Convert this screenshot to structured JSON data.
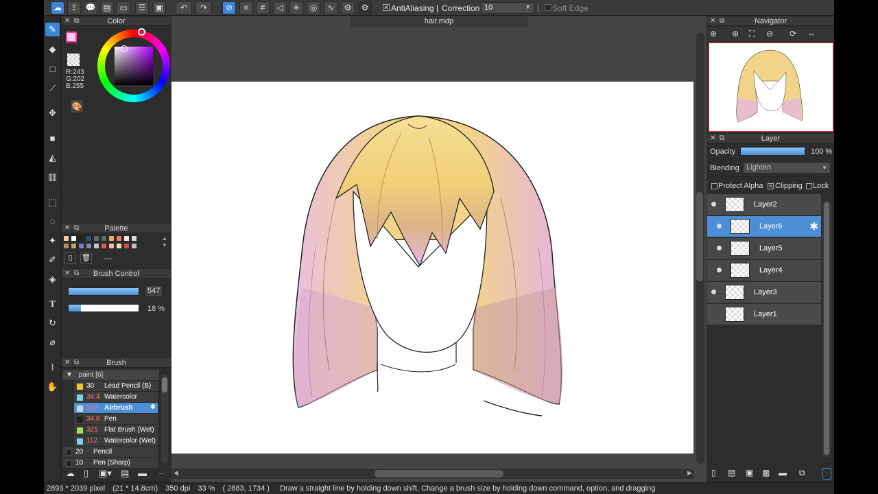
{
  "document": {
    "tab_title": "hair.mdp"
  },
  "toolbar": {
    "antialiasing_label": "AntiAliasing",
    "correction_label": "Correction",
    "correction_value": "10",
    "soft_edge_label": "Soft Edge"
  },
  "color": {
    "title": "Color",
    "rgb": {
      "r": "R:243",
      "g": "G:202",
      "b": "B:255"
    },
    "foreground": "#f3caff",
    "background": "#ffffff"
  },
  "palette": {
    "title": "Palette",
    "swatches": [
      "#f6c7a0",
      "#ffffff",
      "#222222",
      "#3b4b7a",
      "#6a6a6a",
      "#4d6e7c",
      "#e6b25f",
      "#ff7070",
      "#fbe7dc",
      "#d9d9d9",
      "#b88a64",
      "#c2a26a",
      "#7b7bd0",
      "#8a8aaa",
      "#c7c3d0",
      "#e35959",
      "#f7b6b6",
      "#f0e0b0",
      "#cc5050",
      "#c1c1c1"
    ],
    "empty_label": "---"
  },
  "brush_control": {
    "title": "Brush Control",
    "size_value": "547",
    "size_fill": 1.0,
    "opacity_value": "18 %",
    "opacity_fill": 0.18
  },
  "brush": {
    "title": "Brush",
    "group_label": "paint [6]",
    "items": [
      {
        "size": "30",
        "name": "Lead Pencil (B)",
        "color": "#e8c82a",
        "red": false
      },
      {
        "size": "34.4",
        "name": "Watercolor",
        "color": "#7fd3f2",
        "red": true
      },
      {
        "size": "547",
        "name": "Airbrush",
        "color": "#cfd7e6",
        "red": true
      },
      {
        "size": "34.8",
        "name": "Pen",
        "color": "#222222",
        "red": true
      },
      {
        "size": "321",
        "name": "Flat Brush (Wet)",
        "color": "#a6dd5a",
        "red": true
      },
      {
        "size": "112",
        "name": "Watercolor (Wet)",
        "color": "#7fd3f2",
        "red": true
      }
    ],
    "extra_items": [
      {
        "size": "20",
        "name": "Pencil"
      },
      {
        "size": "10",
        "name": "Pen (Sharp)"
      }
    ]
  },
  "navigator": {
    "title": "Navigator"
  },
  "layer": {
    "title": "Layer",
    "opacity_label": "Opacity",
    "opacity_value": "100 %",
    "opacity_fill": 1.0,
    "blending_label": "Blending",
    "blending_value": "Lighten",
    "protect_alpha_label": "Protect Alpha",
    "clipping_label": "Clipping",
    "lock_label": "Lock",
    "items": [
      {
        "name": "Layer2",
        "visible": true,
        "selected": false,
        "clipped": false
      },
      {
        "name": "Layer6",
        "visible": true,
        "selected": true,
        "clipped": true
      },
      {
        "name": "Layer5",
        "visible": true,
        "selected": false,
        "clipped": true
      },
      {
        "name": "Layer4",
        "visible": true,
        "selected": false,
        "clipped": true
      },
      {
        "name": "Layer3",
        "visible": true,
        "selected": false,
        "clipped": false
      },
      {
        "name": "Layer1",
        "visible": false,
        "selected": false,
        "clipped": false
      }
    ]
  },
  "status": {
    "pixels": "2893 * 2039 pixel",
    "size_cm": "(21 * 14.8cm)",
    "dpi": "350 dpi",
    "zoom": "33 %",
    "cursor": "( 2883, 1734 )",
    "hint": "Draw a straight line by holding down shift, Change a brush size by holding down command, option, and dragging"
  }
}
